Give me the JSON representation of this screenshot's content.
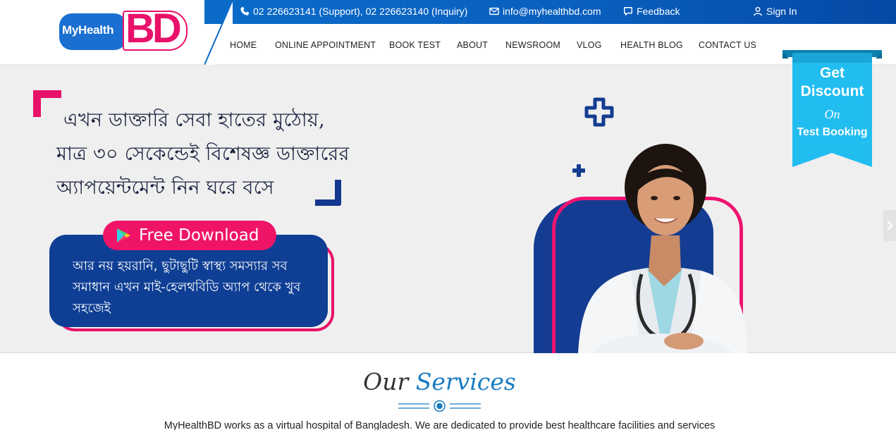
{
  "brand": {
    "logo_left": "MyHealth",
    "logo_right": "BD"
  },
  "topbar": {
    "phone": "02 226623141 (Support), 02 226623140 (Inquiry)",
    "email": "info@myhealthbd.com",
    "feedback": "Feedback",
    "signin": "Sign In"
  },
  "nav": {
    "items": [
      "HOME",
      "ONLINE APPOINTMENT",
      "BOOK TEST",
      "ABOUT",
      "NEWSROOM",
      "VLOG",
      "HEALTH BLOG",
      "CONTACT US"
    ]
  },
  "hero": {
    "lines": [
      "এখন ডাক্তারি সেবা হাতের মুঠোয়,",
      "মাত্র ৩০ সেকেন্ডেই বিশেষজ্ঞ ডাক্তারের",
      "অ্যাপয়েন্টমেন্ট নিন ঘরে বসে"
    ],
    "download_label": "Free Download",
    "card_text": "আর নয় হয়রানি, ছুটাছুটি স্বাস্থ্য সমস্যার সব সমাধান এখন মাই-হেলথবিডি অ্যাপ থেকে খুব সহজেই"
  },
  "ribbon": {
    "line1": "Get",
    "line2": "Discount",
    "line_on": "On",
    "line3": "Test Booking"
  },
  "services": {
    "title_part1": "Our",
    "title_part2": "Services",
    "description": "MyHealthBD works as a virtual hospital of Bangladesh. We are dedicated to provide best healthcare facilities and services"
  },
  "colors": {
    "brand_blue": "#0a6bc9",
    "brand_pink": "#e8126a",
    "navy": "#14388f",
    "ribbon_cyan": "#1fb6e8"
  },
  "icons": [
    "phone-icon",
    "envelope-icon",
    "comment-icon",
    "user-icon",
    "play-store-icon",
    "medical-cross-icon",
    "plus-icon",
    "chevron-right-icon"
  ]
}
